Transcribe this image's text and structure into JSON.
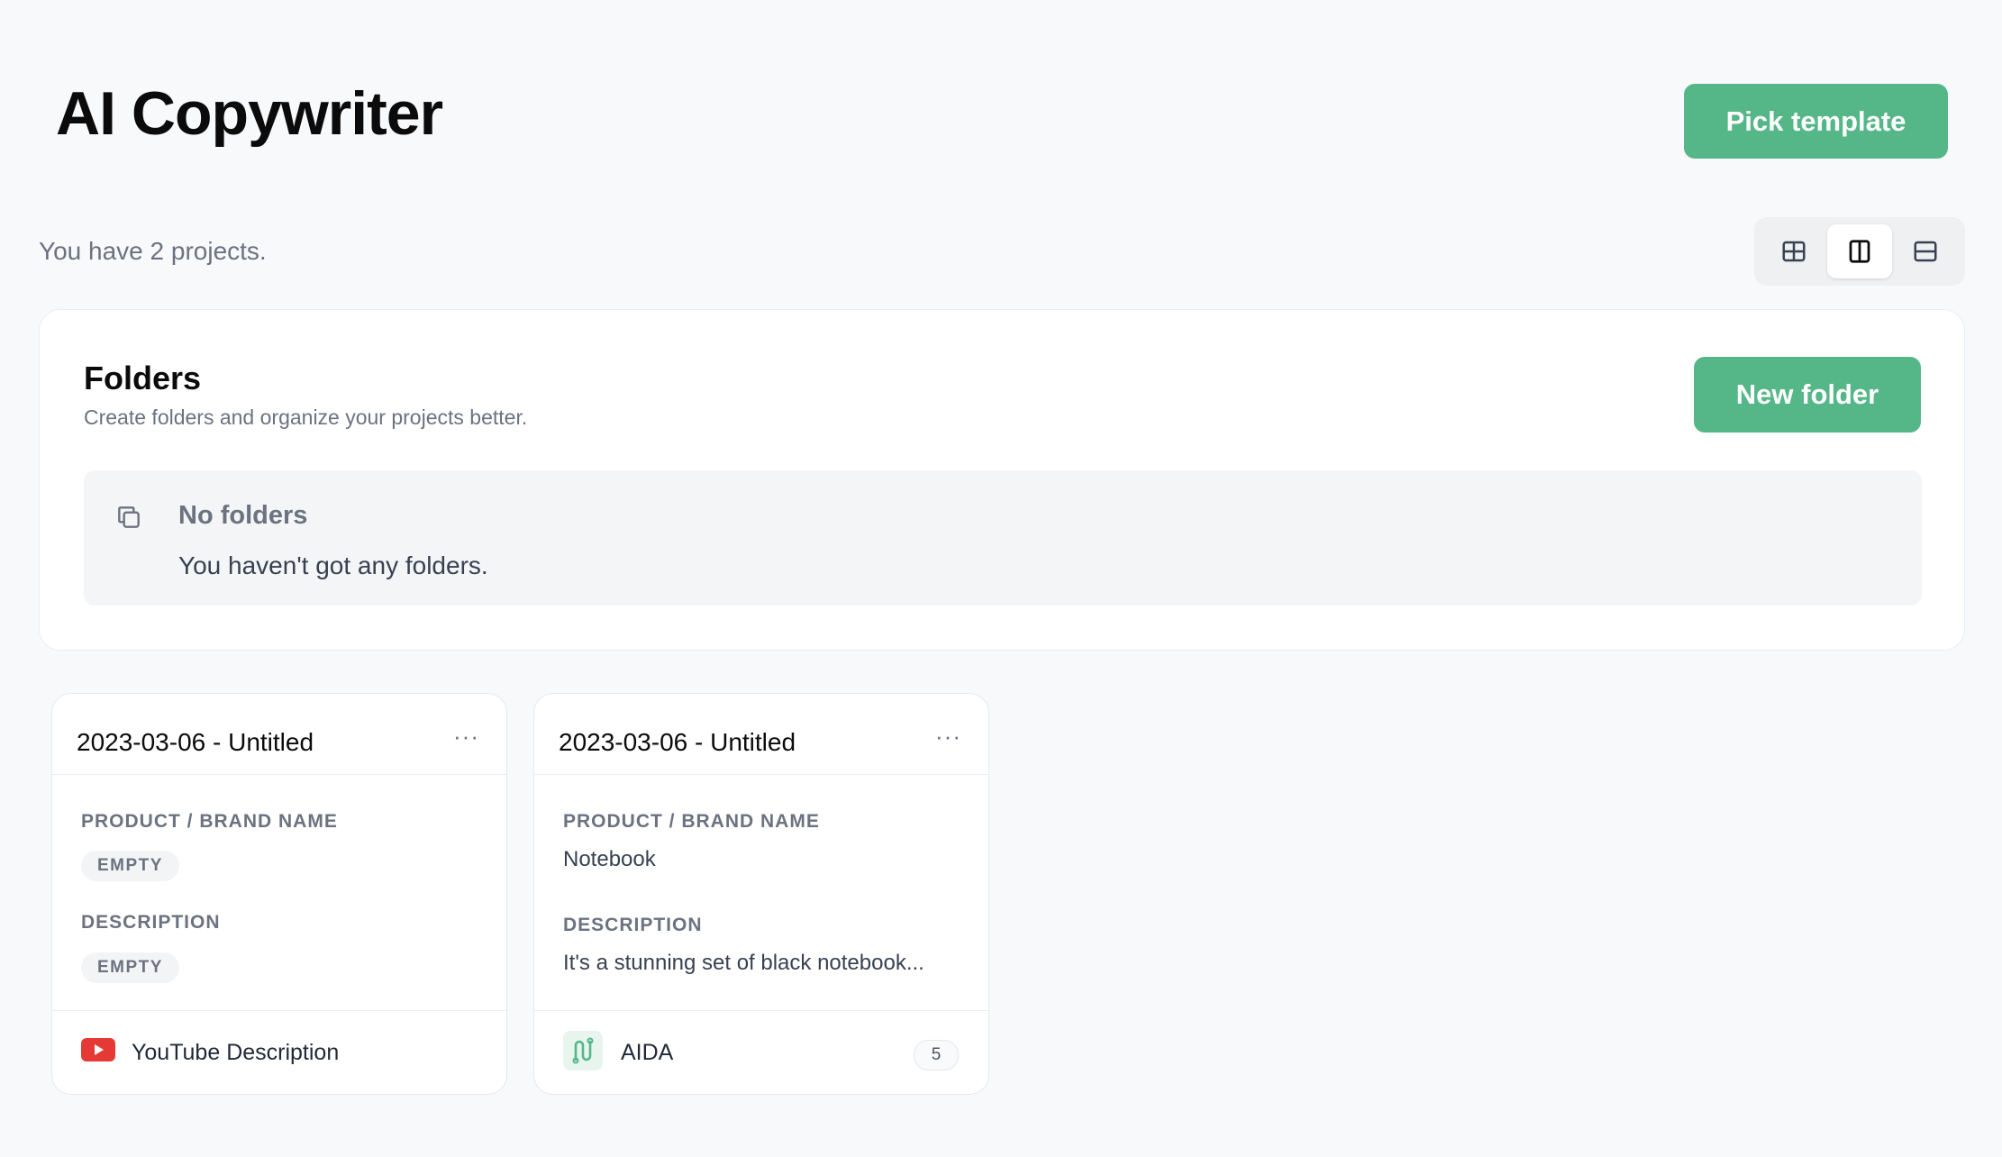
{
  "header": {
    "title": "AI Copywriter",
    "pick_template_label": "Pick template"
  },
  "summary": {
    "project_count_text": "You have 2 projects."
  },
  "view_toggle": {
    "options": [
      "grid-view-icon",
      "columns-view-icon",
      "rows-view-icon"
    ],
    "active": "columns-view-icon"
  },
  "folders": {
    "title": "Folders",
    "subtitle": "Create folders and organize your projects better.",
    "new_folder_label": "New folder",
    "empty": {
      "title": "No folders",
      "description": "You haven't got any folders."
    }
  },
  "projects": [
    {
      "title": "2023-03-06 - Untitled",
      "menu": "···",
      "fields": [
        {
          "label": "PRODUCT / BRAND NAME",
          "value": "EMPTY",
          "empty": true
        },
        {
          "label": "DESCRIPTION",
          "value": "EMPTY",
          "empty": true
        }
      ],
      "template": {
        "name": "YouTube Description",
        "icon": "youtube-icon",
        "count": null
      }
    },
    {
      "title": "2023-03-06 - Untitled",
      "menu": "···",
      "fields": [
        {
          "label": "PRODUCT / BRAND NAME",
          "value": "Notebook",
          "empty": false
        },
        {
          "label": "DESCRIPTION",
          "value": "It's a stunning set of black notebook...",
          "empty": false
        }
      ],
      "template": {
        "name": "AIDA",
        "icon": "aida-icon",
        "count": "5"
      }
    }
  ],
  "colors": {
    "accent": "#55b788",
    "youtube": "#e53935",
    "background": "#f8f9fa"
  }
}
